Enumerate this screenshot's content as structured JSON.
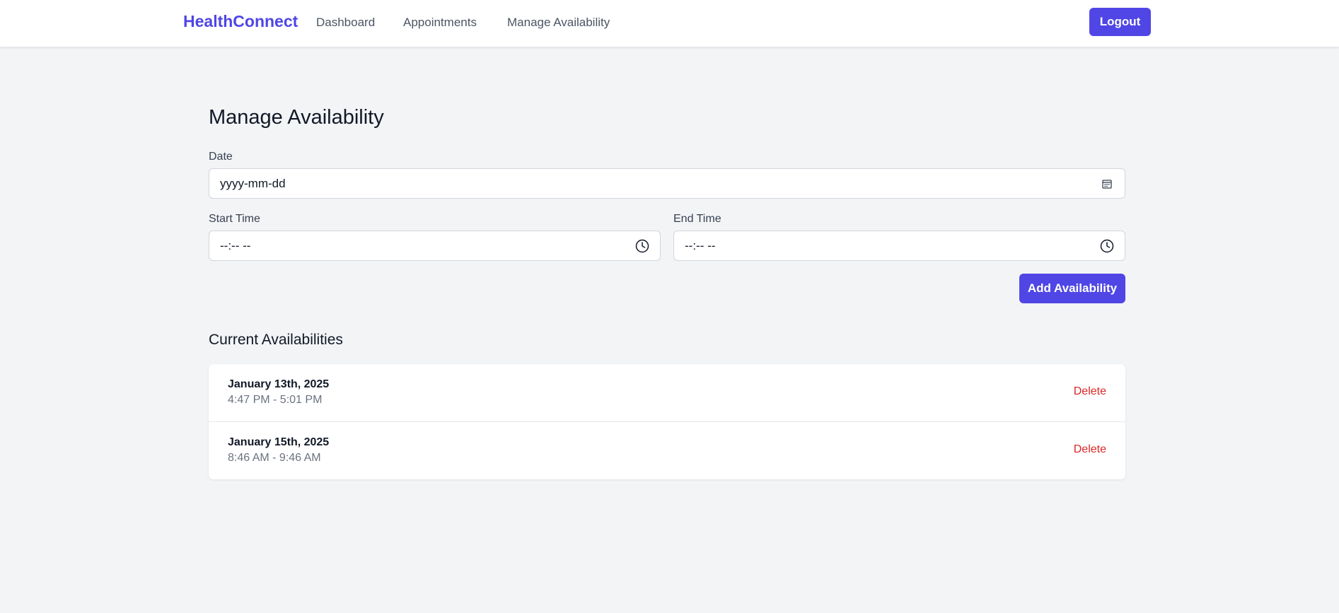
{
  "navbar": {
    "brand": "HealthConnect",
    "links": [
      "Dashboard",
      "Appointments",
      "Manage Availability"
    ],
    "logout_label": "Logout"
  },
  "page": {
    "title": "Manage Availability"
  },
  "form": {
    "date_label": "Date",
    "date_value": "yyyy-mm-dd",
    "date_icon": "calendar-icon",
    "start_label": "Start Time",
    "start_value": "--:-- --",
    "end_label": "End Time",
    "end_value": "--:-- --",
    "time_icon": "clock-icon",
    "submit_label": "Add Availability"
  },
  "availabilities": {
    "title": "Current Availabilities",
    "items": [
      {
        "date": "January 13th, 2025",
        "time": "4:47 PM - 5:01 PM",
        "action": "Delete"
      },
      {
        "date": "January 15th, 2025",
        "time": "8:46 AM - 9:46 AM",
        "action": "Delete"
      }
    ]
  },
  "colors": {
    "accent": "#4f46e5",
    "danger": "#dc2626",
    "background": "#f3f4f6"
  }
}
